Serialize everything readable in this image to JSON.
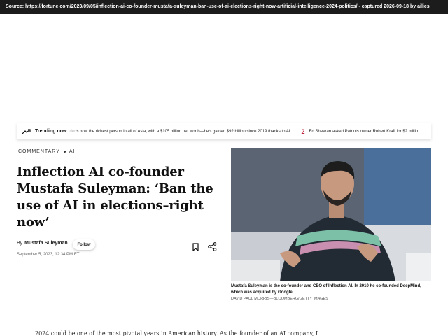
{
  "source_bar": {
    "text": "Source: https://fortune.com/2023/09/05/inflection-ai-co-founder-mustafa-suleyman-ban-use-of-ai-elections-right-now-artificial-intelligence-2024-politics/ - captured 2026-09-18 by ailies"
  },
  "trending": {
    "label": "Trending now",
    "item1_fade": "der",
    "item1_text": " is now the richest person in all of Asia, with a $105 billion net worth—he's gained $92 billion since 2019 thanks to AI",
    "item2_number": "2",
    "item2_text": "Ed Sheeran asked Patriots owner Robert Kraft for $2 millio"
  },
  "article": {
    "kicker_section": "COMMENTARY",
    "kicker_topic": "AI",
    "headline": "Inflection AI co-founder Mustafa Suleyman: ‘Ban the use of AI in elections–right now’",
    "byline_prefix": "By",
    "author": "Mustafa Suleyman",
    "follow_label": "Follow",
    "date": "September 5, 2023, 12:34 PM ET",
    "caption": "Mustafa Suleyman is the co-founder and CEO of Inflection AI. In 2010 he co-founded DeepMind, which was acquired by Google.",
    "credit": "DAVID PAUL MORRIS—BLOOMBERG/GETTY IMAGES",
    "body_first_line": "2024 could be one of the most pivotal years in American history. As the founder of an AI company, I"
  },
  "icons": [
    "trending-icon",
    "bookmark-icon",
    "share-icon"
  ],
  "colors": {
    "accent_red": "#c21d3a",
    "source_bar_bg": "#1c1c1c"
  }
}
